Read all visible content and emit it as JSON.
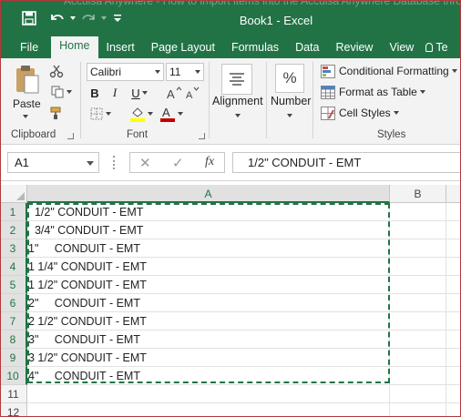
{
  "window": {
    "ghost_title": "Acculsa Anywhere - How to import items into the Acculsa Anywhere Database thro",
    "title": "Book1 - Excel"
  },
  "tabs": [
    "File",
    "Home",
    "Insert",
    "Page Layout",
    "Formulas",
    "Data",
    "Review",
    "View",
    "Te"
  ],
  "active_tab": "Home",
  "ribbon": {
    "clipboard": {
      "paste_label": "Paste",
      "group_label": "Clipboard"
    },
    "font": {
      "name": "Calibri",
      "size": "11",
      "group_label": "Font",
      "bold": "B",
      "italic": "I",
      "underline": "U",
      "font_color": "#c00000",
      "highlight_color": "#ffff00"
    },
    "alignment": {
      "label": "Alignment"
    },
    "number": {
      "label": "Number",
      "icon_glyph": "%"
    },
    "styles": {
      "conditional_formatting": "Conditional Formatting",
      "format_as_table": "Format as Table",
      "cell_styles": "Cell Styles",
      "group_label": "Styles"
    }
  },
  "formula_bar": {
    "name_box": "A1",
    "cancel_glyph": "✕",
    "enter_glyph": "✓",
    "fx_glyph": "fx",
    "formula": "1/2\" CONDUIT - EMT"
  },
  "sheet": {
    "columns": [
      "A",
      "B"
    ],
    "selected_column": "A",
    "rows": [
      {
        "num": "1",
        "a": "  1/2\" CONDUIT - EMT"
      },
      {
        "num": "2",
        "a": "  3/4\" CONDUIT - EMT"
      },
      {
        "num": "3",
        "a": "1\"     CONDUIT - EMT"
      },
      {
        "num": "4",
        "a": "1 1/4\" CONDUIT - EMT"
      },
      {
        "num": "5",
        "a": "1 1/2\" CONDUIT - EMT"
      },
      {
        "num": "6",
        "a": "2\"     CONDUIT - EMT"
      },
      {
        "num": "7",
        "a": "2 1/2\" CONDUIT - EMT"
      },
      {
        "num": "8",
        "a": "3\"     CONDUIT - EMT"
      },
      {
        "num": "9",
        "a": "3 1/2\" CONDUIT - EMT"
      },
      {
        "num": "10",
        "a": "4\"     CONDUIT - EMT"
      },
      {
        "num": "11",
        "a": ""
      },
      {
        "num": "12",
        "a": ""
      }
    ]
  },
  "colors": {
    "brand": "#217346"
  }
}
